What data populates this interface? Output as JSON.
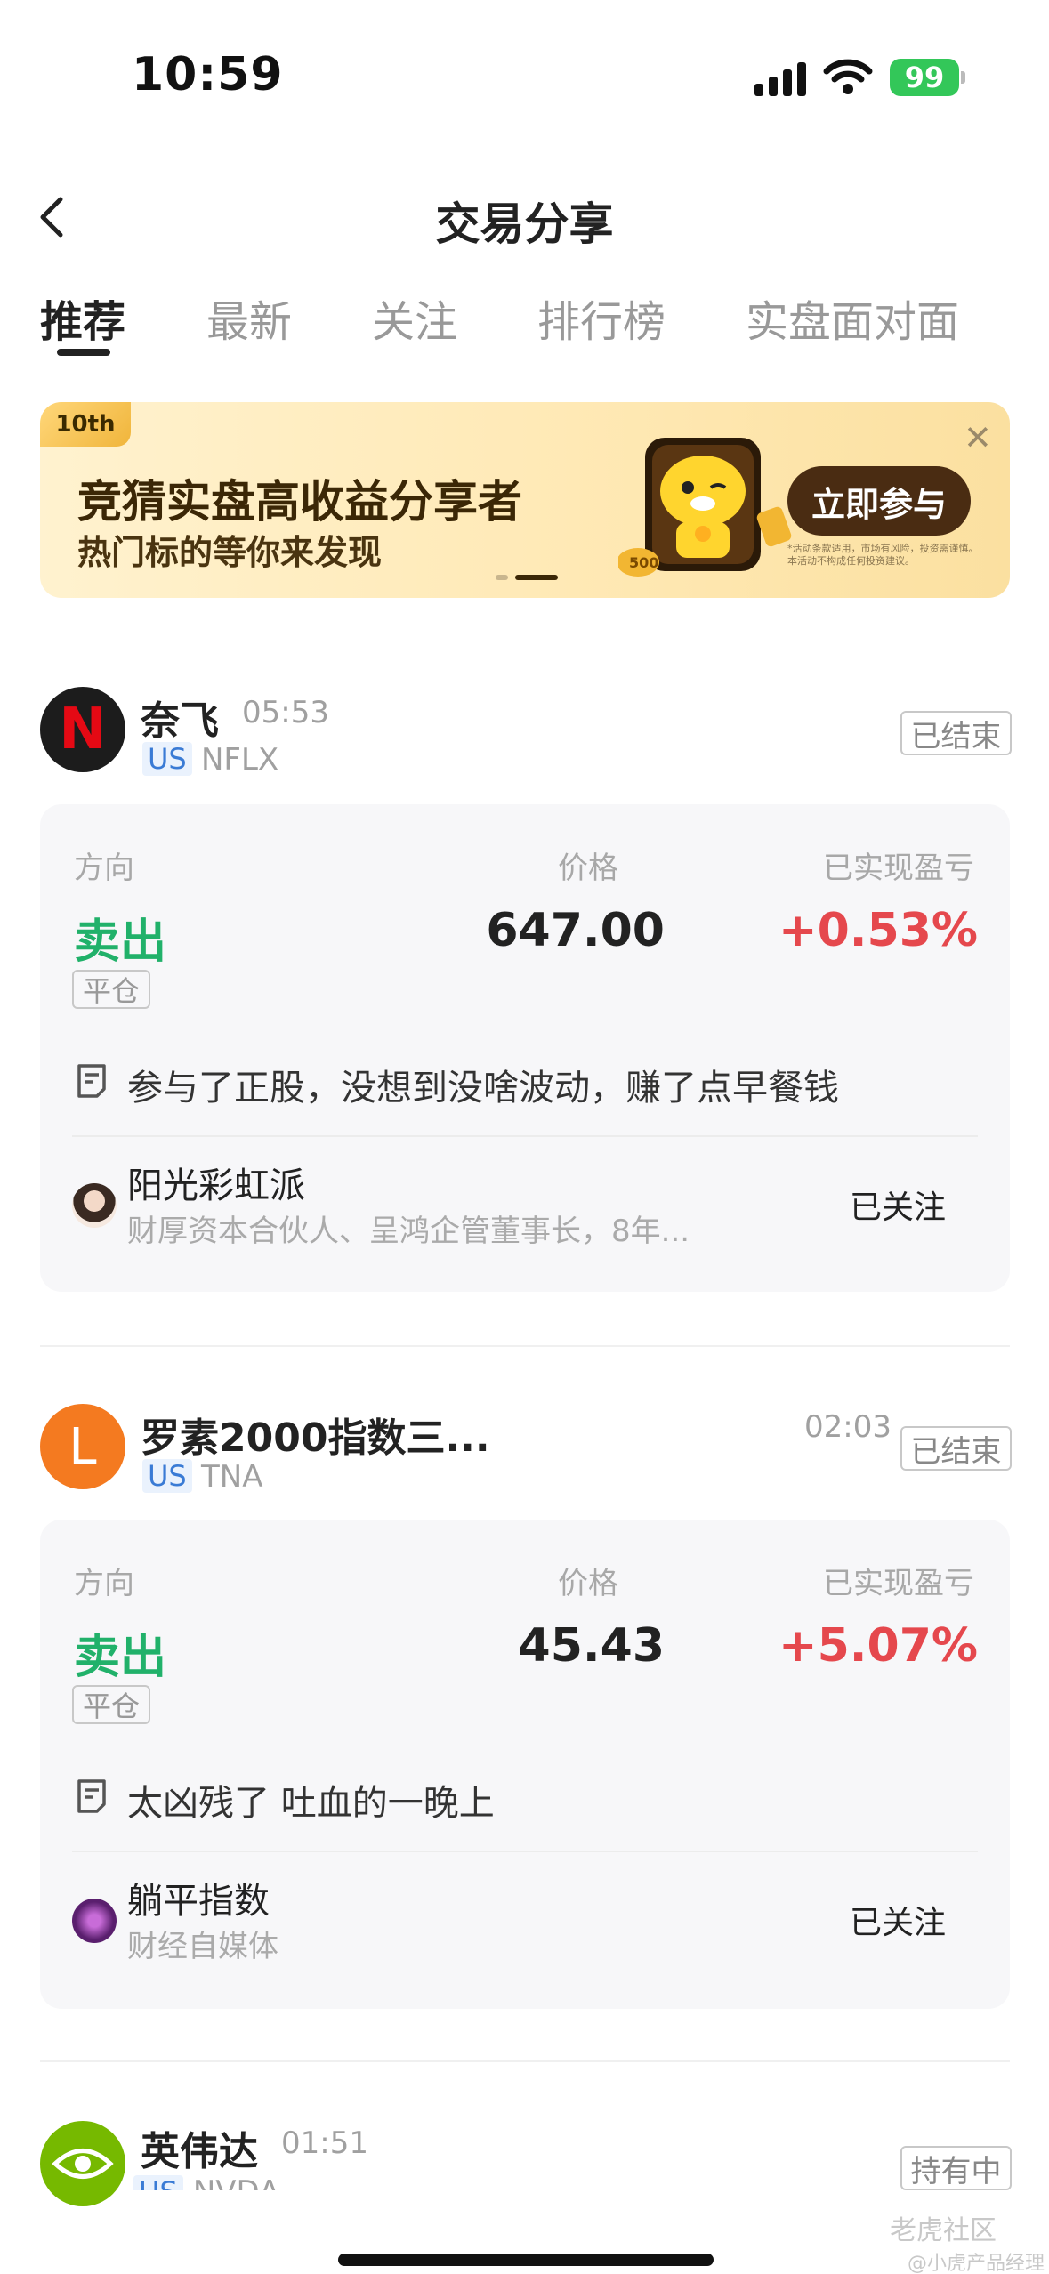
{
  "status_bar": {
    "time": "10:59",
    "battery": "99"
  },
  "header": {
    "title": "交易分享"
  },
  "tabs": [
    {
      "label": "推荐",
      "active": true
    },
    {
      "label": "最新",
      "active": false
    },
    {
      "label": "关注",
      "active": false
    },
    {
      "label": "排行榜",
      "active": false
    },
    {
      "label": "实盘面对面",
      "active": false
    }
  ],
  "banner": {
    "badge": "10th",
    "headline": "竞猜实盘高收益分享者",
    "subline": "热门标的等你来发现",
    "button": "立即参与",
    "note": "*活动条款适用，市场有风险，投资需谨慎。本活动不构成任何投资建议。"
  },
  "labels": {
    "direction": "方向",
    "price": "价格",
    "pnl": "已实现盈亏"
  },
  "trades": [
    {
      "name": "奈飞",
      "time": "05:53",
      "market": "US",
      "ticker": "NFLX",
      "status": "已结束",
      "side": "卖出",
      "tag": "平仓",
      "price": "647.00",
      "pnl": "+0.53%",
      "comment": "参与了正股，没想到没啥波动，赚了点早餐钱",
      "user": {
        "name": "阳光彩虹派",
        "bio": "财厚资本合伙人、呈鸿企管董事长，8年...",
        "follow": "已关注"
      },
      "avatar_letter": "N",
      "avatar_color": "#1c1c1c"
    },
    {
      "name": "罗素2000指数三...",
      "time": "02:03",
      "market": "US",
      "ticker": "TNA",
      "status": "已结束",
      "side": "卖出",
      "tag": "平仓",
      "price": "45.43",
      "pnl": "+5.07%",
      "comment": "太凶残了 吐血的一晚上",
      "user": {
        "name": "躺平指数",
        "bio": "财经自媒体",
        "follow": "已关注"
      },
      "avatar_letter": "L",
      "avatar_color": "#f47a20"
    },
    {
      "name": "英伟达",
      "time": "01:51",
      "market": "US",
      "ticker": "NVDA",
      "status": "持有中",
      "avatar_color": "#76b900"
    }
  ],
  "watermark": {
    "brand": "老虎社区",
    "author": "@小虎产品经理"
  }
}
